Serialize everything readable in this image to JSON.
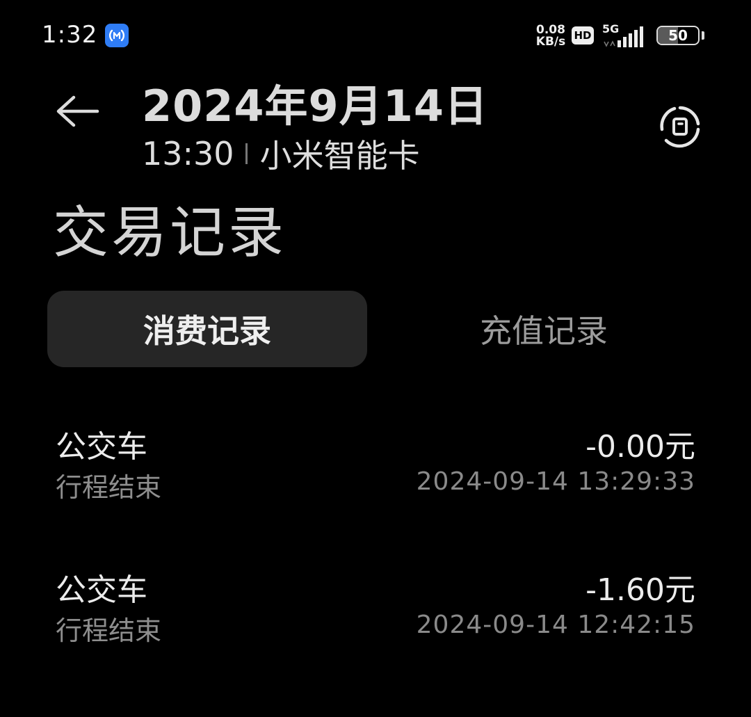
{
  "status_bar": {
    "time": "1:32",
    "net_speed_value": "0.08",
    "net_speed_unit": "KB/s",
    "hd_label": "HD",
    "network_label": "5G",
    "battery_level": "50",
    "battery_fraction": 0.5,
    "nfc_icon": "nfc-app-icon",
    "nfc_color": "#2f7df6"
  },
  "header": {
    "date": "2024年9月14日",
    "time": "13:30",
    "source": "小米智能卡",
    "back_icon": "back-arrow-icon",
    "sync_icon": "refresh-card-icon"
  },
  "page": {
    "title": "交易记录"
  },
  "tabs": [
    {
      "label": "消费记录",
      "active": true
    },
    {
      "label": "充值记录",
      "active": false
    }
  ],
  "transactions": [
    {
      "title": "公交车",
      "subtitle": "行程结束",
      "amount": "-0.00元",
      "time": "2024-09-14 13:29:33"
    },
    {
      "title": "公交车",
      "subtitle": "行程结束",
      "amount": "-1.60元",
      "time": "2024-09-14 12:42:15"
    }
  ]
}
